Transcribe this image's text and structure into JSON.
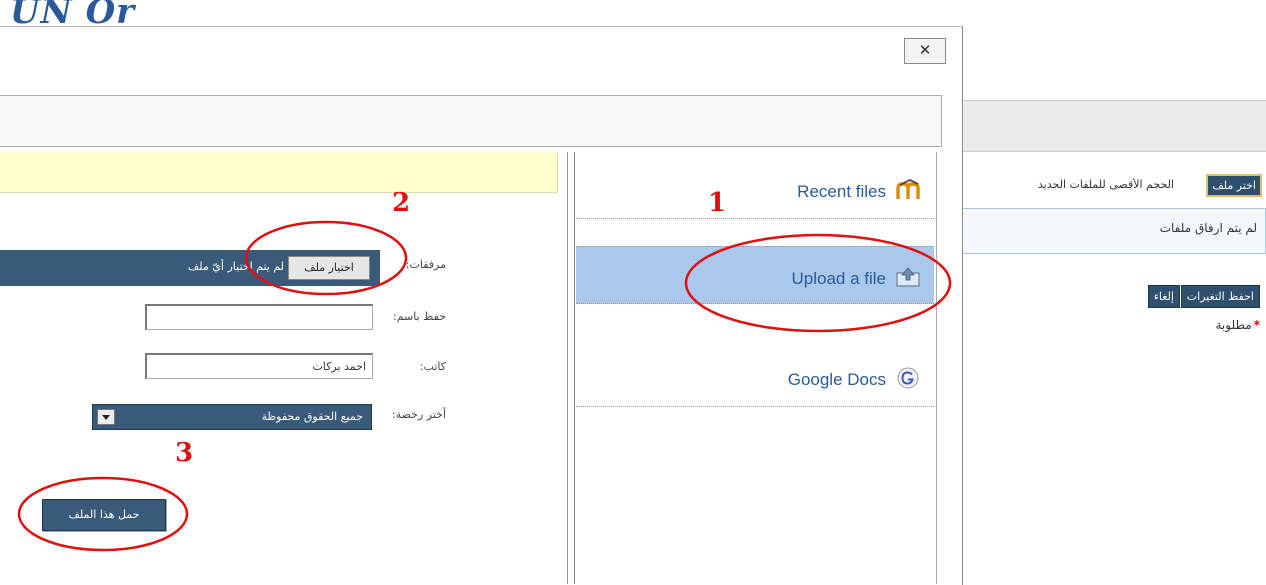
{
  "background": {
    "logo_text": "UN Or",
    "choose_file_label": "اختر ملف",
    "max_size_text": "الحجم الأقصى للملفات الجديد",
    "no_files_text": "لم يتم ارفاق ملفات",
    "save_changes_label": "احفظ التغيرات",
    "cancel_label": "إلغاء",
    "required_text": "مطلوبة",
    "required_star": "*"
  },
  "dialog": {
    "close_symbol": "✕",
    "form": {
      "attachments_label": "مرفقات:",
      "choose_file_button": "اختيار ملف",
      "no_file_chosen": "لم يتم اختيار أيّ ملف",
      "save_as_label": "حفظ باسم:",
      "save_as_value": "",
      "author_label": "كاتب:",
      "author_value": "احمد بركات",
      "license_label": "أختر رخصة:",
      "license_value": "جميع الحقوق محفوظة",
      "upload_button": "حمل هذا الملف"
    },
    "repositories": [
      {
        "label": "Recent files",
        "icon": "moodle-icon"
      },
      {
        "label": "Upload a file",
        "icon": "upload-icon",
        "selected": true
      },
      {
        "label": "Google Docs",
        "icon": "google-icon"
      }
    ]
  },
  "annotations": {
    "step1": "1",
    "step2": "2",
    "step3": "3",
    "color": "#e01010"
  },
  "colors": {
    "accent": "#3a5a7a",
    "selected_repo": "#a9c8eb",
    "notice": "#ffffcc",
    "link": "#2a5a9a"
  }
}
